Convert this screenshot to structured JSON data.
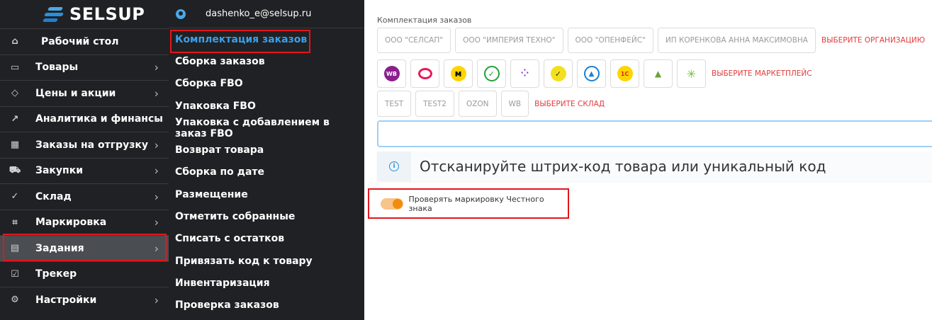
{
  "logo": {
    "text": "SELSUP"
  },
  "user": {
    "email": "dashenko_e@selsup.ru"
  },
  "sidebar": {
    "items": [
      {
        "label": "Рабочий стол",
        "icon": "home-icon",
        "chevron": false
      },
      {
        "label": "Товары",
        "icon": "bag-icon",
        "chevron": true
      },
      {
        "label": "Цены и акции",
        "icon": "tag-icon",
        "chevron": true
      },
      {
        "label": "Аналитика и финансы",
        "icon": "chart-icon",
        "chevron": true
      },
      {
        "label": "Заказы на отгрузку",
        "icon": "box-icon",
        "chevron": true
      },
      {
        "label": "Закупки",
        "icon": "cart-icon",
        "chevron": true
      },
      {
        "label": "Склад",
        "icon": "check-circle-icon",
        "chevron": true
      },
      {
        "label": "Маркировка",
        "icon": "scan-icon",
        "chevron": true
      },
      {
        "label": "Задания",
        "icon": "calendar-list-icon",
        "chevron": true,
        "active": true
      },
      {
        "label": "Трекер",
        "icon": "calendar-check-icon",
        "chevron": false
      },
      {
        "label": "Настройки",
        "icon": "gear-icon",
        "chevron": true
      }
    ]
  },
  "submenu": {
    "items": [
      "Комплектация заказов",
      "Сборка заказов",
      "Сборка FBO",
      "Упаковка FBO",
      "Упаковка с добавлением в заказ FBO",
      "Возврат товара",
      "Сборка по дате",
      "Размещение",
      "Отметить собранные",
      "Списать с остатков",
      "Привязать код к товару",
      "Инвентаризация",
      "Проверка заказов"
    ],
    "active_index": 0
  },
  "main": {
    "section_label": "Комплектация заказов",
    "organizations": [
      "ООО \"СЕЛСАП\"",
      "ООО \"ИМПЕРИЯ ТЕХНО\"",
      "ООО \"ОПЕНФЕЙС\"",
      "ИП КОРЕНКОВА АННА МАКСИМОВНА"
    ],
    "org_hint": "ВЫБЕРИТЕ ОРГАНИЗАЦИЮ",
    "marketplaces": [
      {
        "name": "wildberries-icon",
        "text": "WB",
        "bg": "#8b1f8e",
        "fg": "#ffffff"
      },
      {
        "name": "ozon-icon",
        "text": "",
        "bg": "#ffffff",
        "fg": "#e8185a"
      },
      {
        "name": "yandex-market-icon",
        "text": "",
        "bg": "#ffd400",
        "fg": "#000000"
      },
      {
        "name": "sber-icon",
        "text": "",
        "bg": "#ffffff",
        "fg": "#21a038"
      },
      {
        "name": "dots-icon",
        "text": "",
        "bg": "#ffffff",
        "fg": "#8b3fd6"
      },
      {
        "name": "goods-icon",
        "text": "",
        "bg": "#f2e01e",
        "fg": "#333333"
      },
      {
        "name": "delta-icon",
        "text": "",
        "bg": "#ffffff",
        "fg": "#1a7fd4"
      },
      {
        "name": "1c-icon",
        "text": "1С",
        "bg": "#ffd400",
        "fg": "#e31e24"
      },
      {
        "name": "leroy-icon",
        "text": "",
        "bg": "#ffffff",
        "fg": "#6aa337"
      },
      {
        "name": "spark-icon",
        "text": "",
        "bg": "#ffffff",
        "fg": "#7ac143"
      }
    ],
    "mp_hint": "ВЫБЕРИТЕ МАРКЕТПЛЕЙС",
    "warehouses": [
      "TEST",
      "TEST2",
      "OZON",
      "WB"
    ],
    "wh_hint": "ВЫБЕРИТЕ СКЛАД",
    "scan_value": "",
    "info_text": "Отсканируйте штрих-код товара или уникальный код",
    "toggle_label": "Проверять маркировку Честного знака",
    "toggle_on": true
  }
}
